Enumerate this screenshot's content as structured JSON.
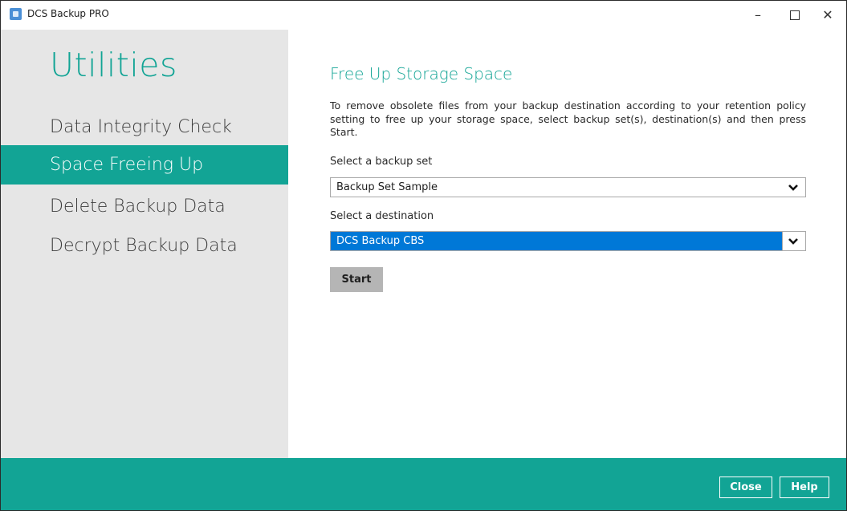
{
  "window": {
    "title": "DCS Backup PRO",
    "controls": {
      "minimize": "–",
      "close": "✕"
    }
  },
  "sidebar": {
    "title": "Utilities",
    "items": [
      {
        "label": "Data Integrity Check",
        "active": false
      },
      {
        "label": "Space Freeing Up",
        "active": true
      },
      {
        "label": "Delete Backup Data",
        "active": false
      },
      {
        "label": "Decrypt Backup Data",
        "active": false
      }
    ]
  },
  "main": {
    "title": "Free Up Storage Space",
    "description": "To remove obsolete files from your backup destination according to your retention policy setting to free up your storage space, select backup set(s), destination(s) and then press Start.",
    "backup_set_label": "Select a backup set",
    "backup_set_value": "Backup Set Sample",
    "destination_label": "Select a destination",
    "destination_value": "DCS Backup CBS",
    "start_label": "Start"
  },
  "footer": {
    "close_label": "Close",
    "help_label": "Help"
  },
  "colors": {
    "accent": "#12a495",
    "selection": "#0078d7",
    "sidebar_bg": "#e6e6e6"
  }
}
